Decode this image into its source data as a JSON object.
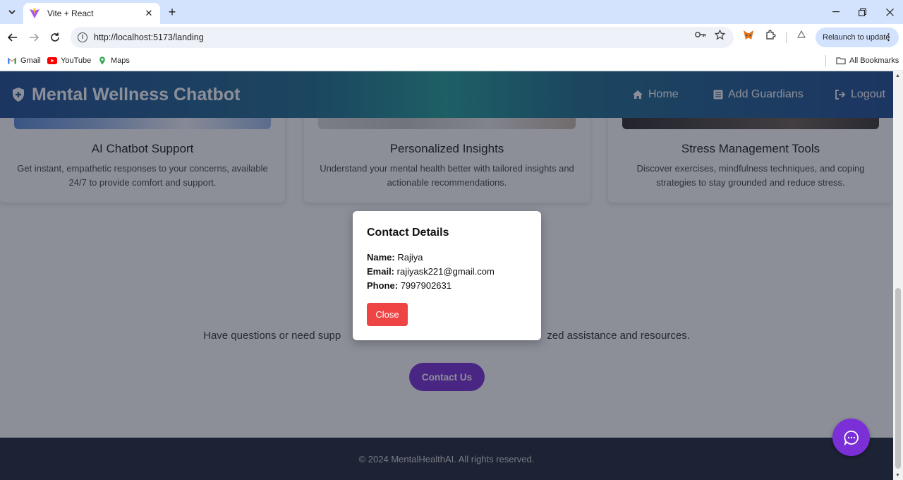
{
  "browser": {
    "tab_title": "Vite + React",
    "url": "http://localhost:5173/landing",
    "relaunch_label": "Relaunch to update",
    "bookmarks": [
      {
        "label": "Gmail"
      },
      {
        "label": "YouTube"
      },
      {
        "label": "Maps"
      }
    ],
    "all_bookmarks_label": "All Bookmarks"
  },
  "header": {
    "brand": "Mental Wellness Chatbot",
    "nav": [
      {
        "label": "Home",
        "icon": "home-icon"
      },
      {
        "label": "Add Guardians",
        "icon": "list-icon"
      },
      {
        "label": "Logout",
        "icon": "logout-icon"
      }
    ]
  },
  "features": [
    {
      "title": "AI Chatbot Support",
      "description": "Get instant, empathetic responses to your concerns, available 24/7 to provide comfort and support."
    },
    {
      "title": "Personalized Insights",
      "description": "Understand your mental health better with tailored insights and actionable recommendations."
    },
    {
      "title": "Stress Management Tools",
      "description": "Discover exercises, mindfulness techniques, and coping strategies to stay grounded and reduce stress."
    }
  ],
  "contact": {
    "text_visible": "Have questions or need supp…zed assistance and resources.",
    "text_left": "Have questions or need supp",
    "text_right": "zed assistance and resources.",
    "button_label": "Contact Us"
  },
  "modal": {
    "title": "Contact Details",
    "name_label": "Name:",
    "name_value": "Rajiya",
    "email_label": "Email:",
    "email_value": "rajiyask221@gmail.com",
    "phone_label": "Phone:",
    "phone_value": "7997902631",
    "close_label": "Close"
  },
  "footer": {
    "text": "© 2024 MentalHealthAI. All rights reserved."
  },
  "colors": {
    "accent_purple": "#7b2fd6",
    "close_red": "#ef4444",
    "footer_bg": "#1f2937"
  }
}
